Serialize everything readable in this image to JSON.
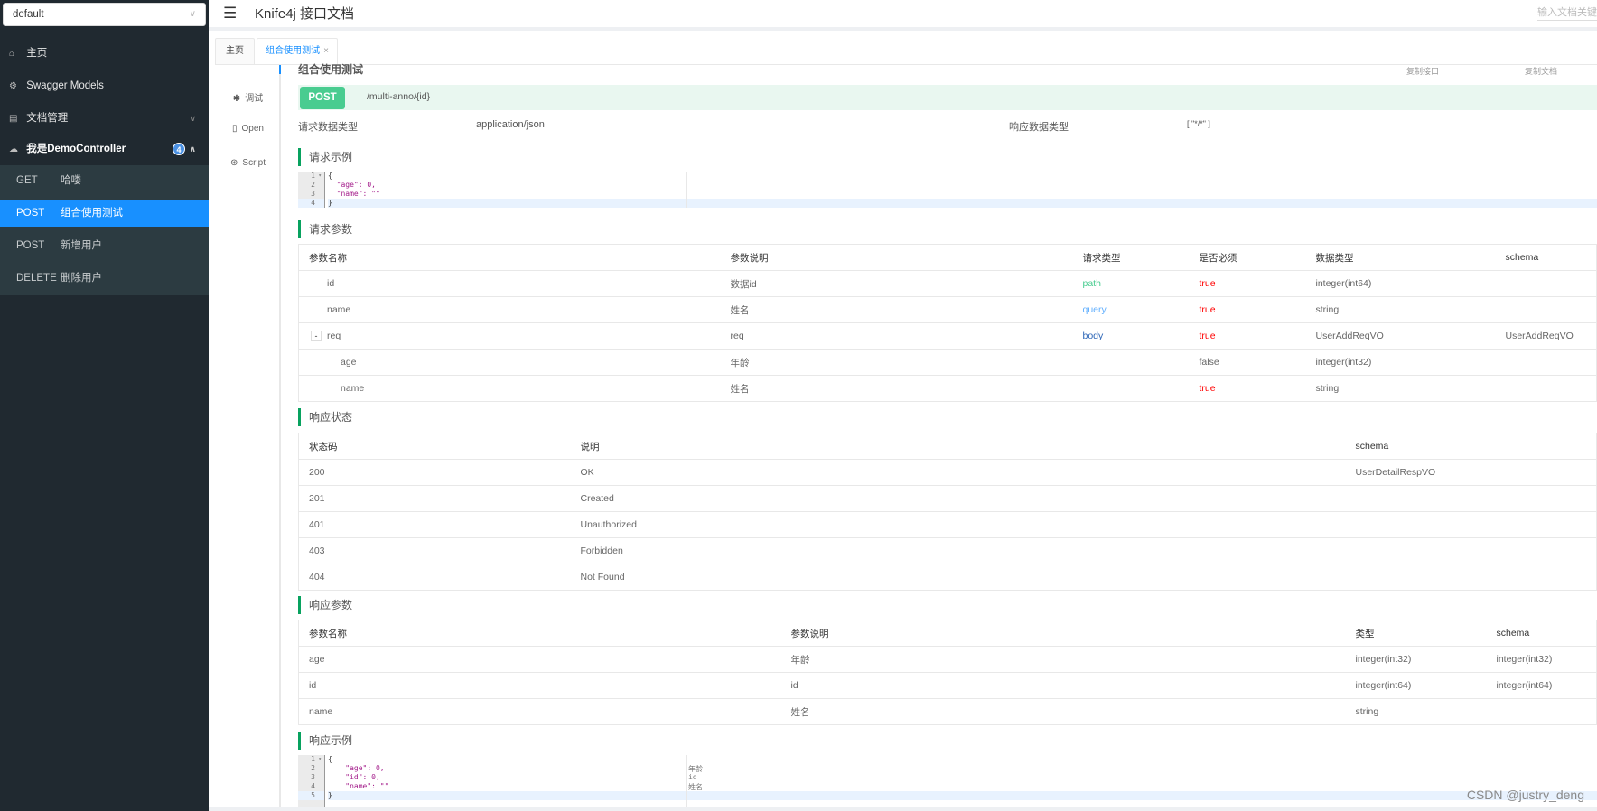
{
  "sidebar": {
    "group_select": "default",
    "items": [
      {
        "icon": "home-icon",
        "label": "主页"
      },
      {
        "icon": "cube-icon",
        "label": "Swagger Models"
      },
      {
        "icon": "document-icon",
        "label": "文档管理"
      }
    ],
    "controller": {
      "icon": "cloud-icon",
      "label": "我是DemoController",
      "count": "4"
    },
    "endpoints": [
      {
        "method": "GET",
        "label": "哈喽",
        "active": false
      },
      {
        "method": "POST",
        "label": "组合使用测试",
        "active": true
      },
      {
        "method": "POST",
        "label": "新增用户",
        "active": false
      },
      {
        "method": "DELETE",
        "label": "删除用户",
        "active": false
      }
    ]
  },
  "header": {
    "title": "Knife4j 接口文档",
    "search_placeholder": "输入文档关键字"
  },
  "tabs": [
    {
      "label": "主页"
    },
    {
      "label": "组合使用测试",
      "close": "×"
    }
  ],
  "vnav": [
    {
      "icon": "bug-icon",
      "label": "调试"
    },
    {
      "icon": "file-icon",
      "label": "Open"
    },
    {
      "icon": "script-icon",
      "label": "Script"
    }
  ],
  "api": {
    "title": "组合使用测试",
    "copy_api": "复制接口",
    "copy_doc": "复制文档",
    "method": "POST",
    "path": "/multi-anno/{id}",
    "request_type_label": "请求数据类型",
    "request_type": "application/json",
    "response_type_label": "响应数据类型",
    "response_type": "[ \"*/*\" ]"
  },
  "request_example": {
    "title": "请求示例",
    "lines": [
      "{",
      "  \"age\": 0,",
      "  \"name\": \"\"",
      "}"
    ]
  },
  "request_params": {
    "title": "请求参数",
    "headers": [
      "参数名称",
      "参数说明",
      "请求类型",
      "是否必须",
      "数据类型",
      "schema"
    ],
    "rows": [
      {
        "name": "id",
        "desc": "数据id",
        "in": "path",
        "required": "true",
        "type": "integer(int64)",
        "schema": "",
        "level": 0
      },
      {
        "name": "name",
        "desc": "姓名",
        "in": "query",
        "required": "true",
        "type": "string",
        "schema": "",
        "level": 0
      },
      {
        "name": "req",
        "desc": "req",
        "in": "body",
        "required": "true",
        "type": "UserAddReqVO",
        "schema": "UserAddReqVO",
        "level": 0,
        "expand": "-"
      },
      {
        "name": "age",
        "desc": "年龄",
        "in": "",
        "required": "false",
        "type": "integer(int32)",
        "schema": "",
        "level": 1
      },
      {
        "name": "name",
        "desc": "姓名",
        "in": "",
        "required": "true",
        "type": "string",
        "schema": "",
        "level": 1
      }
    ]
  },
  "response_status": {
    "title": "响应状态",
    "headers": [
      "状态码",
      "说明",
      "schema"
    ],
    "rows": [
      {
        "code": "200",
        "desc": "OK",
        "schema": "UserDetailRespVO"
      },
      {
        "code": "201",
        "desc": "Created",
        "schema": ""
      },
      {
        "code": "401",
        "desc": "Unauthorized",
        "schema": ""
      },
      {
        "code": "403",
        "desc": "Forbidden",
        "schema": ""
      },
      {
        "code": "404",
        "desc": "Not Found",
        "schema": ""
      }
    ]
  },
  "response_params": {
    "title": "响应参数",
    "headers": [
      "参数名称",
      "参数说明",
      "类型",
      "schema"
    ],
    "rows": [
      {
        "name": "age",
        "desc": "年龄",
        "type": "integer(int32)",
        "schema": "integer(int32)"
      },
      {
        "name": "id",
        "desc": "id",
        "type": "integer(int64)",
        "schema": "integer(int64)"
      },
      {
        "name": "name",
        "desc": "姓名",
        "type": "string",
        "schema": ""
      }
    ]
  },
  "response_example": {
    "title": "响应示例",
    "lines": [
      "{",
      "    \"age\": 0,",
      "    \"id\": 0,",
      "    \"name\": \"\"",
      "}"
    ],
    "comments": [
      "",
      "年龄",
      "id",
      "姓名",
      ""
    ]
  },
  "watermark": "CSDN @justry_deng"
}
